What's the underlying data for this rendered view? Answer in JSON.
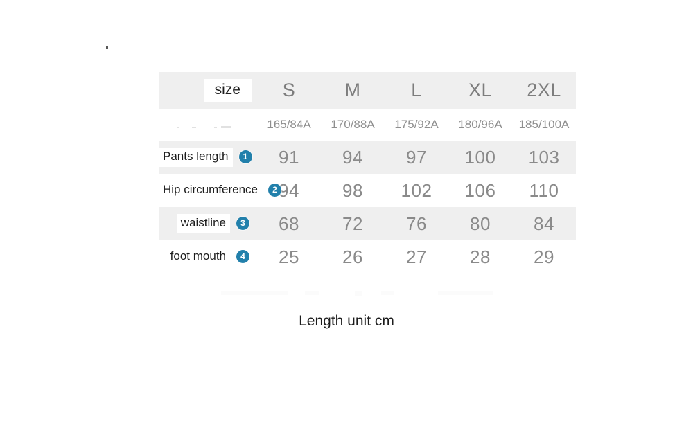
{
  "table": {
    "header": {
      "label": "size",
      "sizes": [
        "S",
        "M",
        "L",
        "XL",
        "2XL"
      ]
    },
    "spec_row": {
      "label": "",
      "codes": [
        "165/84A",
        "170/88A",
        "175/92A",
        "180/96A",
        "185/100A"
      ]
    },
    "rows": [
      {
        "label": "Pants length",
        "badge": "1",
        "values": [
          "91",
          "94",
          "97",
          "100",
          "103"
        ]
      },
      {
        "label": "Hip circumference",
        "badge": "2",
        "values": [
          "94",
          "98",
          "102",
          "106",
          "110"
        ]
      },
      {
        "label": "waistline",
        "badge": "3",
        "values": [
          "68",
          "72",
          "76",
          "80",
          "84"
        ]
      },
      {
        "label": "foot mouth",
        "badge": "4",
        "values": [
          "25",
          "26",
          "27",
          "28",
          "29"
        ]
      }
    ]
  },
  "caption": "Length unit cm",
  "colors": {
    "badge": "#2280ab",
    "row_shaded": "#efefef",
    "row_plain": "#ffffff",
    "value_text": "#8a8a8a",
    "label_text": "#1c1c1c"
  },
  "chart_data": {
    "type": "table",
    "title": "Size chart",
    "columns": [
      "size",
      "S",
      "M",
      "L",
      "XL",
      "2XL"
    ],
    "subheader": [
      "",
      "165/84A",
      "170/88A",
      "175/92A",
      "180/96A",
      "185/100A"
    ],
    "rows": [
      {
        "measurement": "Pants length",
        "index": 1,
        "S": 91,
        "M": 94,
        "L": 97,
        "XL": 100,
        "2XL": 103
      },
      {
        "measurement": "Hip circumference",
        "index": 2,
        "S": 94,
        "M": 98,
        "L": 102,
        "XL": 106,
        "2XL": 110
      },
      {
        "measurement": "waistline",
        "index": 3,
        "S": 68,
        "M": 72,
        "L": 76,
        "XL": 80,
        "2XL": 84
      },
      {
        "measurement": "foot mouth",
        "index": 4,
        "S": 25,
        "M": 26,
        "L": 27,
        "XL": 28,
        "2XL": 29
      }
    ],
    "unit": "cm",
    "note": "Length unit cm"
  }
}
